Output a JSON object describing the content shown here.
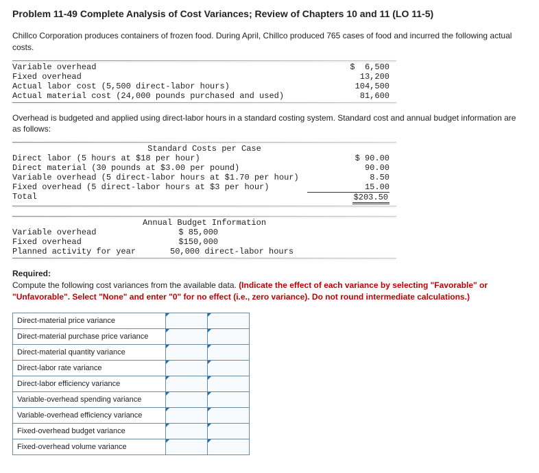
{
  "title": "Problem 11-49 Complete Analysis of Cost Variances; Review of Chapters 10 and 11 (LO 11-5)",
  "intro": "Chillco Corporation produces containers of frozen food. During April, Chillco produced 765 cases of food and incurred the following actual costs.",
  "actual_costs": [
    {
      "label": "Variable overhead",
      "value": "$  6,500"
    },
    {
      "label": "Fixed overhead",
      "value": "13,200"
    },
    {
      "label": "Actual labor cost (5,500 direct-labor hours)",
      "value": "104,500"
    },
    {
      "label": "Actual material cost (24,000 pounds purchased and used)",
      "value": "81,600"
    }
  ],
  "overhead_para": "Overhead is budgeted and applied using direct-labor hours in a standard costing system. Standard cost and annual budget information are as follows:",
  "std_header": "Standard Costs per Case",
  "std_costs": [
    {
      "label": "Direct labor (5 hours at $18 per hour)",
      "value": "$ 90.00"
    },
    {
      "label": "Direct material (30 pounds at $3.00 per pound)",
      "value": "90.00"
    },
    {
      "label": "Variable overhead (5 direct-labor hours at $1.70 per hour)",
      "value": "8.50"
    },
    {
      "label": "Fixed overhead (5 direct-labor hours at $3 per hour)",
      "value": "15.00"
    }
  ],
  "std_total_label": "Total",
  "std_total_value": "$203.50",
  "budget_header": "Annual Budget Information",
  "budget": [
    {
      "label": "Variable overhead",
      "value": "$ 85,000"
    },
    {
      "label": "Fixed overhead",
      "value": "$150,000"
    },
    {
      "label": "Planned activity for year",
      "value": "50,000 direct-labor hours"
    }
  ],
  "required_label": "Required:",
  "required_text": "Compute the following cost variances from the available data. ",
  "required_red": "(Indicate the effect of each variance by selecting \"Favorable\" or \"Unfavorable\". Select \"None\" and enter \"0\" for no effect (i.e., zero variance). Do not round intermediate calculations.)",
  "answer_rows": [
    "Direct-material price variance",
    "Direct-material purchase price variance",
    "Direct-material quantity variance",
    "Direct-labor rate variance",
    "Direct-labor efficiency variance",
    "Variable-overhead spending variance",
    "Variable-overhead efficiency variance",
    "Fixed-overhead budget variance",
    "Fixed-overhead volume variance"
  ]
}
